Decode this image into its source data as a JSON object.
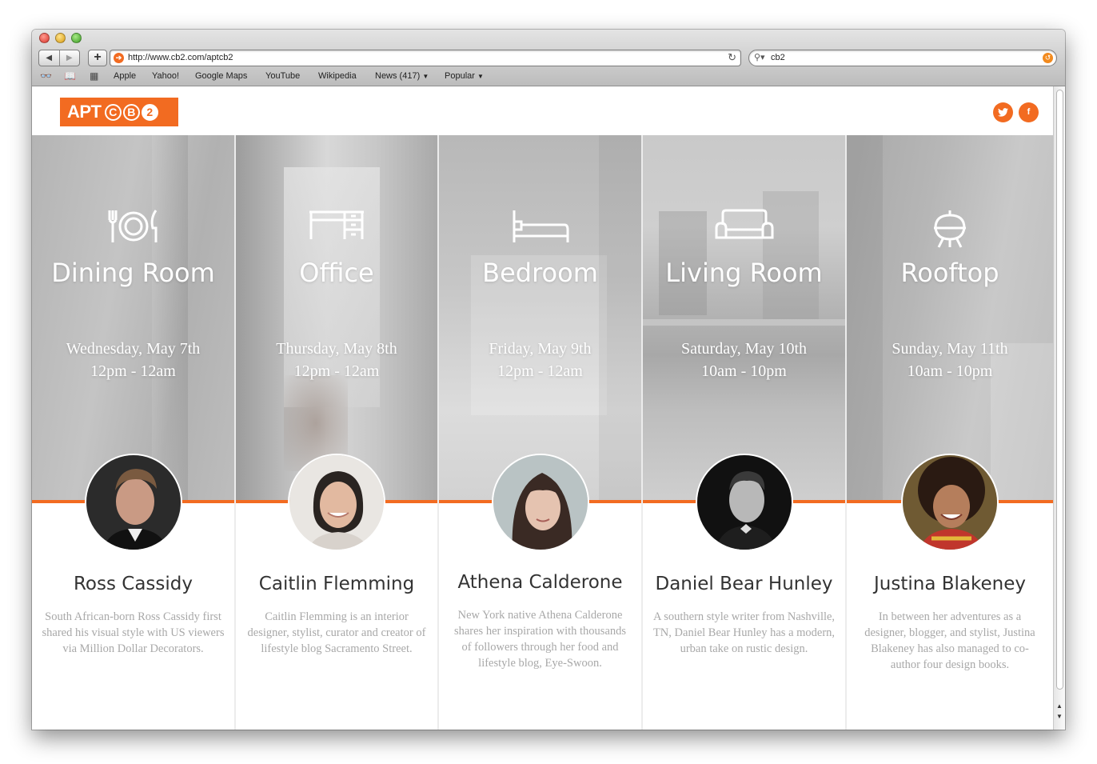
{
  "browser": {
    "url": "http://www.cb2.com/aptcb2",
    "search_query": "cb2",
    "bookmarks": [
      "Apple",
      "Yahoo!",
      "Google Maps",
      "YouTube",
      "Wikipedia",
      "News (417)",
      "Popular"
    ]
  },
  "header": {
    "logo_text": "APT",
    "logo_letters": [
      "C",
      "B",
      "2"
    ],
    "social_icons": [
      "twitter-icon",
      "facebook-icon"
    ]
  },
  "colors": {
    "accent": "#f26b21"
  },
  "rooms": [
    {
      "icon": "dining-icon",
      "name": "Dining Room",
      "date": "Wednesday, May 7th",
      "time": "12pm - 12am",
      "host": "Ross Cassidy",
      "bio": "South African-born Ross Cassidy first shared his visual style with US viewers via Million Dollar Decorators."
    },
    {
      "icon": "desk-icon",
      "name": "Office",
      "date": "Thursday, May 8th",
      "time": "12pm - 12am",
      "host": "Caitlin Flemming",
      "bio": "Caitlin Flemming is an interior designer, stylist, curator and creator of lifestyle blog Sacramento Street."
    },
    {
      "icon": "bed-icon",
      "name": "Bedroom",
      "date": "Friday, May 9th",
      "time": "12pm - 12am",
      "host": "Athena Calderone",
      "bio": "New York native Athena Calderone shares her inspiration with thousands of followers through her food and lifestyle blog, Eye-Swoon."
    },
    {
      "icon": "sofa-icon",
      "name": "Living Room",
      "date": "Saturday, May 10th",
      "time": "10am - 10pm",
      "host": "Daniel Bear Hunley",
      "bio": "A southern style writer from Nashville, TN, Daniel Bear Hunley has a modern, urban take on rustic design."
    },
    {
      "icon": "grill-icon",
      "name": "Rooftop",
      "date": "Sunday, May 11th",
      "time": "10am - 10pm",
      "host": "Justina Blakeney",
      "bio": "In between her adventures as a designer, blogger, and stylist, Justina Blakeney has also managed to co-author four design books."
    }
  ]
}
